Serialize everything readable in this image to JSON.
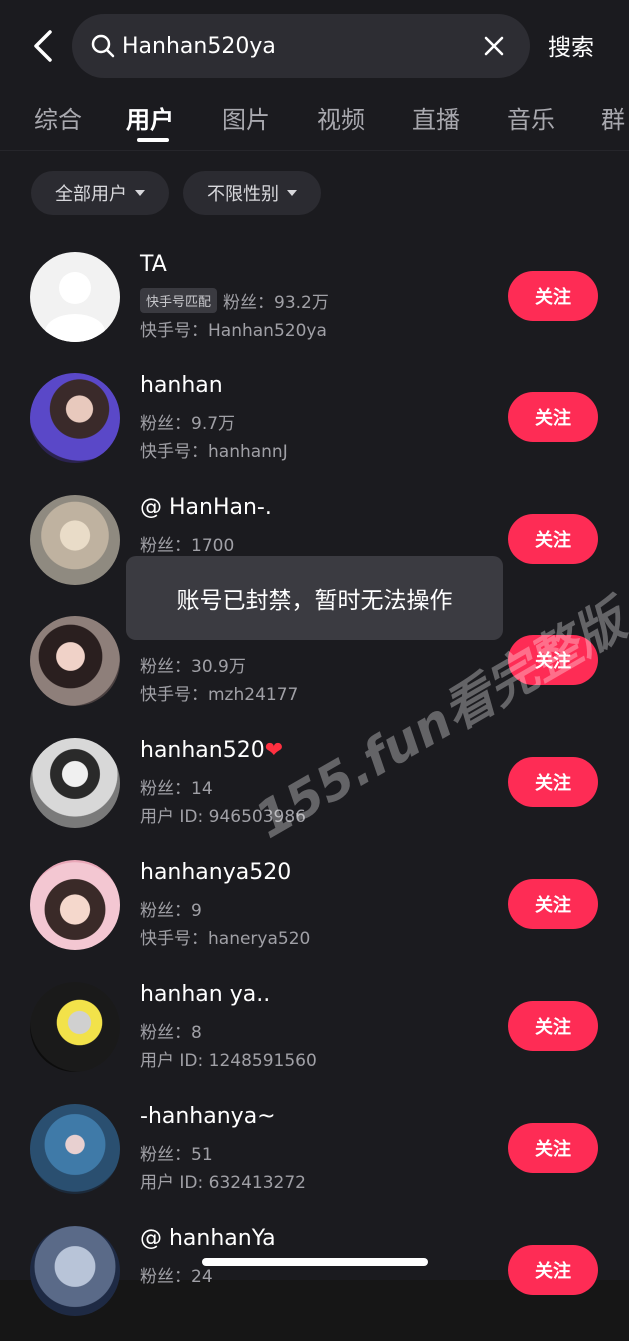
{
  "search": {
    "query": "Hanhan520ya",
    "submit_label": "搜索"
  },
  "tabs": [
    {
      "label": "综合"
    },
    {
      "label": "用户"
    },
    {
      "label": "图片"
    },
    {
      "label": "视频"
    },
    {
      "label": "直播"
    },
    {
      "label": "音乐"
    },
    {
      "label": "群"
    }
  ],
  "filters": {
    "user_type": "全部用户",
    "gender": "不限性别"
  },
  "users": [
    {
      "name": "TA",
      "badge": "快手号匹配",
      "fans": "粉丝：93.2万",
      "account": "快手号：Hanhan520ya",
      "follow": "关注"
    },
    {
      "name": "hanhan",
      "fans": "粉丝：9.7万",
      "account": "快手号：hanhannJ",
      "follow": "关注"
    },
    {
      "name": "@ HanHan-.",
      "fans": "粉丝：1700",
      "follow": "关注"
    },
    {
      "fans": "粉丝：30.9万",
      "account": "快手号：mzh24177",
      "follow": "关注"
    },
    {
      "name": "hanhan520",
      "fans": "粉丝：14",
      "account": "用户 ID: 946503986",
      "follow": "关注"
    },
    {
      "name": "hanhanya520",
      "fans": "粉丝：9",
      "account": "快手号：hanerya520",
      "follow": "关注"
    },
    {
      "name": "hanhan ya..",
      "fans": "粉丝：8",
      "account": "用户 ID: 1248591560",
      "follow": "关注"
    },
    {
      "name": "-hanhanya~",
      "fans": "粉丝：51",
      "account": "用户 ID: 632413272",
      "follow": "关注"
    },
    {
      "name": "@ hanhanYa",
      "fans": "粉丝：24",
      "follow": "关注"
    }
  ],
  "toast": "账号已封禁，暂时无法操作",
  "watermark": "155.fun看完整版",
  "colors": {
    "background": "#1b1b1f",
    "accent": "#fe2c55"
  }
}
